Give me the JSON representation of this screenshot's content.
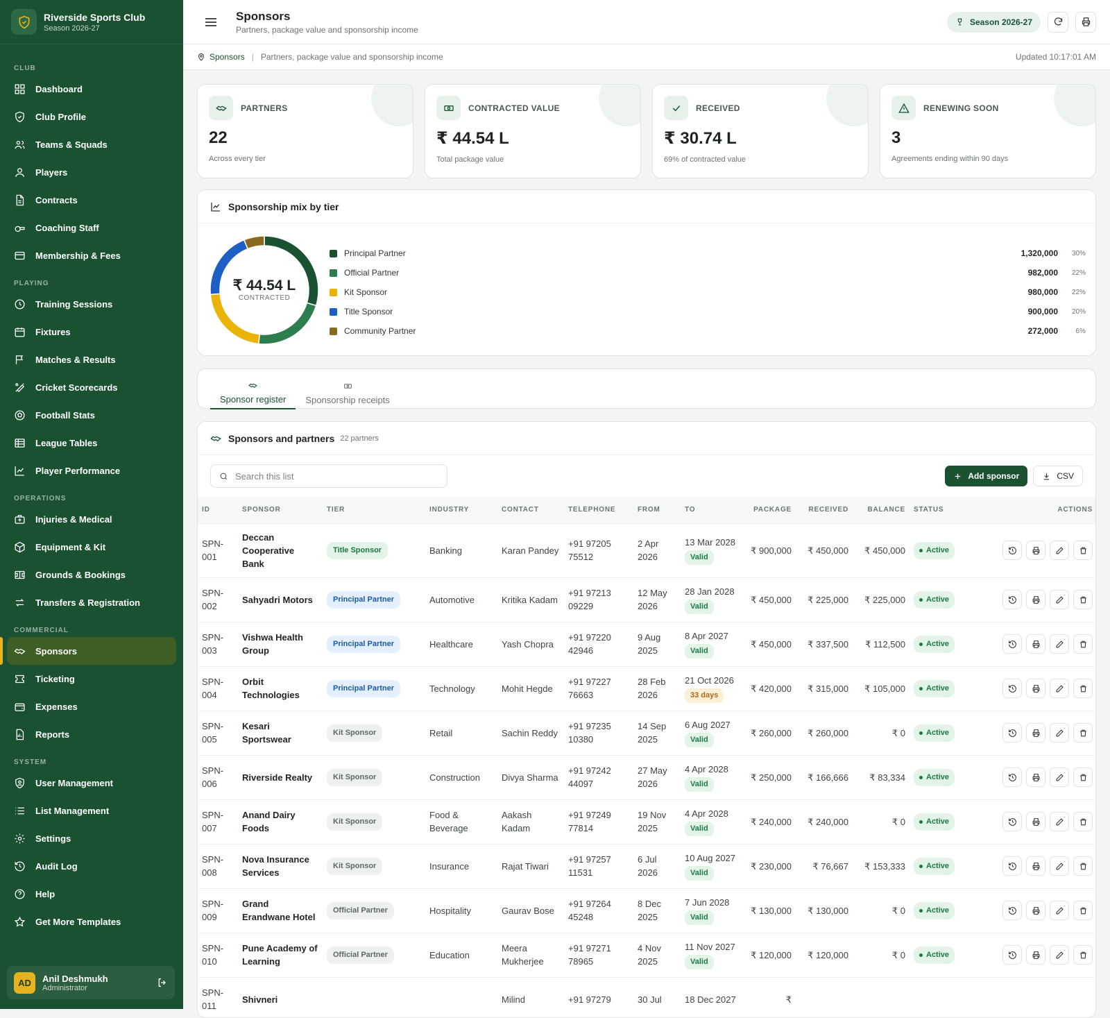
{
  "app": {
    "name": "Riverside Sports Club",
    "season": "Season 2026-27"
  },
  "sidebar": {
    "sections": [
      {
        "label": "CLUB",
        "items": [
          {
            "label": "Dashboard",
            "icon": "grid-icon"
          },
          {
            "label": "Club Profile",
            "icon": "shield-icon"
          },
          {
            "label": "Teams & Squads",
            "icon": "users-icon"
          },
          {
            "label": "Players",
            "icon": "user-icon"
          },
          {
            "label": "Contracts",
            "icon": "file-icon"
          },
          {
            "label": "Coaching Staff",
            "icon": "whistle-icon"
          },
          {
            "label": "Membership & Fees",
            "icon": "card-icon"
          }
        ]
      },
      {
        "label": "PLAYING",
        "items": [
          {
            "label": "Training Sessions",
            "icon": "clock-icon"
          },
          {
            "label": "Fixtures",
            "icon": "calendar-icon"
          },
          {
            "label": "Matches & Results",
            "icon": "flag-icon"
          },
          {
            "label": "Cricket Scorecards",
            "icon": "bat-icon"
          },
          {
            "label": "Football Stats",
            "icon": "ball-icon"
          },
          {
            "label": "League Tables",
            "icon": "table-icon"
          },
          {
            "label": "Player Performance",
            "icon": "chart-icon"
          }
        ]
      },
      {
        "label": "OPERATIONS",
        "items": [
          {
            "label": "Injuries & Medical",
            "icon": "medkit-icon"
          },
          {
            "label": "Equipment & Kit",
            "icon": "box-icon"
          },
          {
            "label": "Grounds & Bookings",
            "icon": "stadium-icon"
          },
          {
            "label": "Transfers & Registration",
            "icon": "swap-icon"
          }
        ]
      },
      {
        "label": "COMMERCIAL",
        "items": [
          {
            "label": "Sponsors",
            "icon": "handshake-icon",
            "active": true
          },
          {
            "label": "Ticketing",
            "icon": "ticket-icon"
          },
          {
            "label": "Expenses",
            "icon": "wallet-icon"
          },
          {
            "label": "Reports",
            "icon": "report-icon"
          }
        ]
      },
      {
        "label": "SYSTEM",
        "items": [
          {
            "label": "User Management",
            "icon": "user-shield-icon"
          },
          {
            "label": "List Management",
            "icon": "list-icon"
          },
          {
            "label": "Settings",
            "icon": "gear-icon"
          },
          {
            "label": "Audit Log",
            "icon": "history-icon"
          },
          {
            "label": "Help",
            "icon": "help-icon"
          },
          {
            "label": "Get More Templates",
            "icon": "star-icon"
          }
        ]
      }
    ]
  },
  "user": {
    "initials": "AD",
    "name": "Anil Deshmukh",
    "role": "Administrator"
  },
  "header": {
    "title": "Sponsors",
    "subtitle": "Partners, package value and sponsorship income",
    "season": "Season 2026-27"
  },
  "breadcrumb": {
    "current": "Sponsors",
    "desc": "Partners, package value and sponsorship income",
    "updated": "Updated 10:17:01 AM"
  },
  "kpis": [
    {
      "label": "PARTNERS",
      "value": "22",
      "sub": "Across every tier"
    },
    {
      "label": "CONTRACTED VALUE",
      "value": "₹ 44.54 L",
      "sub": "Total package value"
    },
    {
      "label": "RECEIVED",
      "value": "₹ 30.74 L",
      "sub": "69% of contracted value"
    },
    {
      "label": "RENEWING SOON",
      "value": "3",
      "sub": "Agreements ending within 90 days"
    }
  ],
  "mix": {
    "title": "Sponsorship mix by tier",
    "center_value": "₹ 44.54 L",
    "center_label": "CONTRACTED"
  },
  "chart_data": {
    "type": "pie",
    "title": "Sponsorship mix by tier",
    "categories": [
      "Principal Partner",
      "Official Partner",
      "Kit Sponsor",
      "Title Sponsor",
      "Community Partner"
    ],
    "values": [
      1320000,
      982000,
      980000,
      900000,
      272000
    ],
    "labels": [
      "1,320,000",
      "982,000",
      "980,000",
      "900,000",
      "272,000"
    ],
    "percents": [
      "30%",
      "22%",
      "22%",
      "20%",
      "6%"
    ],
    "colors": [
      "#1a5131",
      "#2e7d4f",
      "#eab308",
      "#1d5fc4",
      "#8a6a1e"
    ]
  },
  "tabs": [
    {
      "label": "Sponsor register"
    },
    {
      "label": "Sponsorship receipts"
    }
  ],
  "list": {
    "title": "Sponsors and partners",
    "count": "22 partners",
    "search_placeholder": "Search this list",
    "add_label": "Add sponsor",
    "csv_label": "CSV"
  },
  "table": {
    "headers": [
      "ID",
      "SPONSOR",
      "TIER",
      "INDUSTRY",
      "CONTACT",
      "TELEPHONE",
      "FROM",
      "TO",
      "PACKAGE",
      "RECEIVED",
      "BALANCE",
      "STATUS",
      "ACTIONS"
    ],
    "rows": [
      {
        "id": "SPN-001",
        "sponsor": "Deccan Cooperative Bank",
        "tier": "Title Sponsor",
        "tc": "b-title",
        "industry": "Banking",
        "contact": "Karan Pandey",
        "tel": "+91 97205 75512",
        "from": "2 Apr 2026",
        "to": "13 Mar 2028",
        "chip": "Valid",
        "cc": "c-valid",
        "pkg": "₹ 900,000",
        "rec": "₹ 450,000",
        "bal": "₹ 450,000",
        "status": "Active"
      },
      {
        "id": "SPN-002",
        "sponsor": "Sahyadri Motors",
        "tier": "Principal Partner",
        "tc": "b-prin",
        "industry": "Automotive",
        "contact": "Kritika Kadam",
        "tel": "+91 97213 09229",
        "from": "12 May 2026",
        "to": "28 Jan 2028",
        "chip": "Valid",
        "cc": "c-valid",
        "pkg": "₹ 450,000",
        "rec": "₹ 225,000",
        "bal": "₹ 225,000",
        "status": "Active"
      },
      {
        "id": "SPN-003",
        "sponsor": "Vishwa Health Group",
        "tier": "Principal Partner",
        "tc": "b-prin",
        "industry": "Healthcare",
        "contact": "Yash Chopra",
        "tel": "+91 97220 42946",
        "from": "9 Aug 2025",
        "to": "8 Apr 2027",
        "chip": "Valid",
        "cc": "c-valid",
        "pkg": "₹ 450,000",
        "rec": "₹ 337,500",
        "bal": "₹ 112,500",
        "status": "Active"
      },
      {
        "id": "SPN-004",
        "sponsor": "Orbit Technologies",
        "tier": "Principal Partner",
        "tc": "b-prin",
        "industry": "Technology",
        "contact": "Mohit Hegde",
        "tel": "+91 97227 76663",
        "from": "28 Feb 2026",
        "to": "21 Oct 2026",
        "chip": "33 days",
        "cc": "c-soon",
        "pkg": "₹ 420,000",
        "rec": "₹ 315,000",
        "bal": "₹ 105,000",
        "status": "Active"
      },
      {
        "id": "SPN-005",
        "sponsor": "Kesari Sportswear",
        "tier": "Kit Sponsor",
        "tc": "b-kit",
        "industry": "Retail",
        "contact": "Sachin Reddy",
        "tel": "+91 97235 10380",
        "from": "14 Sep 2025",
        "to": "6 Aug 2027",
        "chip": "Valid",
        "cc": "c-valid",
        "pkg": "₹ 260,000",
        "rec": "₹ 260,000",
        "bal": "₹ 0",
        "status": "Active"
      },
      {
        "id": "SPN-006",
        "sponsor": "Riverside Realty",
        "tier": "Kit Sponsor",
        "tc": "b-kit",
        "industry": "Construction",
        "contact": "Divya Sharma",
        "tel": "+91 97242 44097",
        "from": "27 May 2026",
        "to": "4 Apr 2028",
        "chip": "Valid",
        "cc": "c-valid",
        "pkg": "₹ 250,000",
        "rec": "₹ 166,666",
        "bal": "₹ 83,334",
        "status": "Active"
      },
      {
        "id": "SPN-007",
        "sponsor": "Anand Dairy Foods",
        "tier": "Kit Sponsor",
        "tc": "b-kit",
        "industry": "Food & Beverage",
        "contact": "Aakash Kadam",
        "tel": "+91 97249 77814",
        "from": "19 Nov 2025",
        "to": "4 Apr 2028",
        "chip": "Valid",
        "cc": "c-valid",
        "pkg": "₹ 240,000",
        "rec": "₹ 240,000",
        "bal": "₹ 0",
        "status": "Active"
      },
      {
        "id": "SPN-008",
        "sponsor": "Nova Insurance Services",
        "tier": "Kit Sponsor",
        "tc": "b-kit",
        "industry": "Insurance",
        "contact": "Rajat Tiwari",
        "tel": "+91 97257 11531",
        "from": "6 Jul 2026",
        "to": "10 Aug 2027",
        "chip": "Valid",
        "cc": "c-valid",
        "pkg": "₹ 230,000",
        "rec": "₹ 76,667",
        "bal": "₹ 153,333",
        "status": "Active"
      },
      {
        "id": "SPN-009",
        "sponsor": "Grand Erandwane Hotel",
        "tier": "Official Partner",
        "tc": "b-off",
        "industry": "Hospitality",
        "contact": "Gaurav Bose",
        "tel": "+91 97264 45248",
        "from": "8 Dec 2025",
        "to": "7 Jun 2028",
        "chip": "Valid",
        "cc": "c-valid",
        "pkg": "₹ 130,000",
        "rec": "₹ 130,000",
        "bal": "₹ 0",
        "status": "Active"
      },
      {
        "id": "SPN-010",
        "sponsor": "Pune Academy of Learning",
        "tier": "Official Partner",
        "tc": "b-off",
        "industry": "Education",
        "contact": "Meera Mukherjee",
        "tel": "+91 97271 78965",
        "from": "4 Nov 2025",
        "to": "11 Nov 2027",
        "chip": "Valid",
        "cc": "c-valid",
        "pkg": "₹ 120,000",
        "rec": "₹ 120,000",
        "bal": "₹ 0",
        "status": "Active"
      },
      {
        "id": "SPN-011",
        "sponsor": "Shivneri",
        "tier": "",
        "tc": "b-off",
        "industry": "",
        "contact": "Milind",
        "tel": "+91 97279",
        "from": "30 Jul",
        "to": "18 Dec 2027",
        "chip": "",
        "cc": "c-valid",
        "pkg": "₹",
        "rec": "",
        "bal": "",
        "status": ""
      }
    ]
  }
}
